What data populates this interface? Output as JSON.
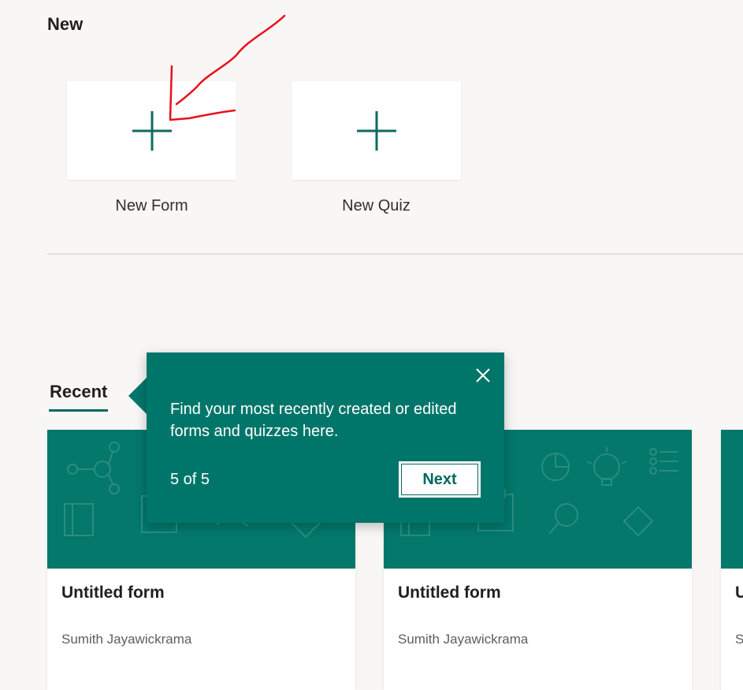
{
  "new_section": {
    "title": "New",
    "tiles": [
      {
        "label": "New Form",
        "icon": "plus-icon"
      },
      {
        "label": "New Quiz",
        "icon": "plus-icon"
      }
    ]
  },
  "recent_section": {
    "tab_label": "Recent",
    "cards": [
      {
        "title": "Untitled form",
        "owner": "Sumith Jayawickrama"
      },
      {
        "title": "Untitled form",
        "owner": "Sumith Jayawickrama"
      },
      {
        "title": "U",
        "owner": "S"
      }
    ]
  },
  "callout": {
    "text": "Find your most recently created or edited forms and quizzes here.",
    "step": "5 of 5",
    "next_label": "Next",
    "close_icon": "close-icon"
  },
  "colors": {
    "accent": "#03786b",
    "callout_bg": "#00766a",
    "background": "#f8f7f6",
    "annotation": "#e8101a"
  }
}
